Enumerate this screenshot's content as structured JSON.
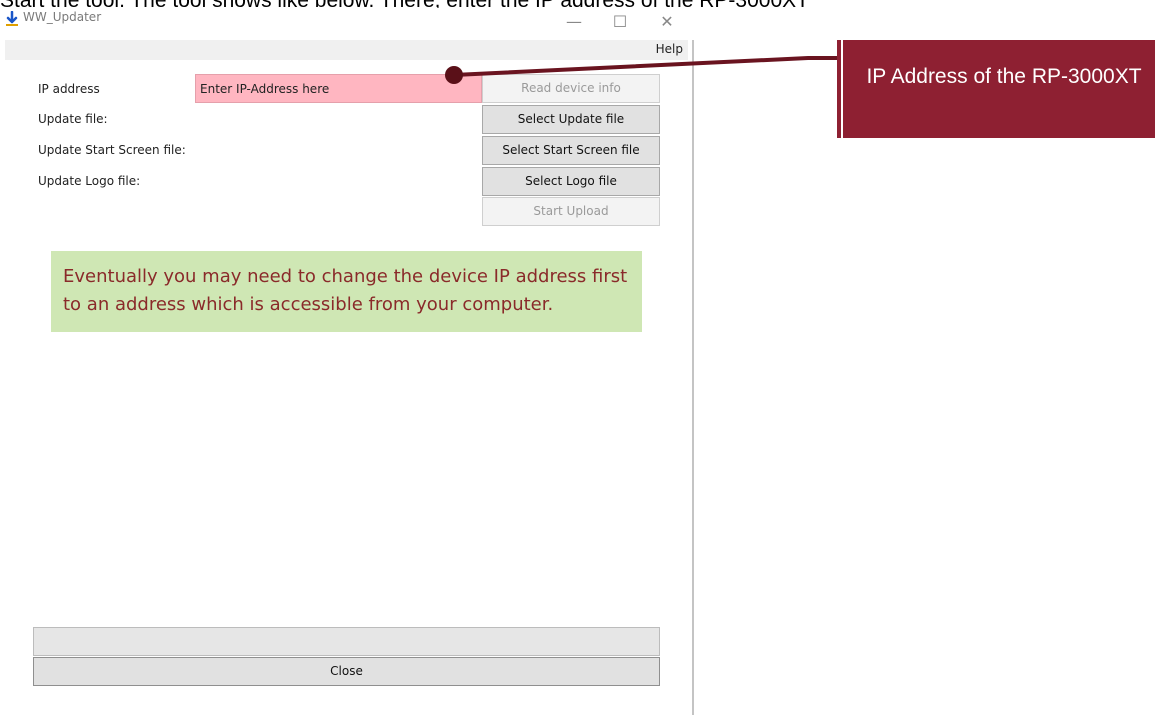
{
  "document": {
    "intro_text": "Start the tool. The tool shows like below. There, enter the IP address of the RP-3000XT"
  },
  "window": {
    "title": "WW_Updater",
    "controls": {
      "minimize": "—",
      "maximize": "☐",
      "close": "✕"
    },
    "menu": {
      "help": "Help"
    }
  },
  "form": {
    "labels": {
      "ip_address": "IP address",
      "update_file": "Update file:",
      "start_screen_file": "Update Start Screen file:",
      "logo_file": "Update Logo file:"
    },
    "ip_input": {
      "placeholder": "Enter IP-Address here",
      "value": ""
    },
    "buttons": {
      "read_device_info": "Read device info",
      "select_update_file": "Select Update file",
      "select_start_screen_file": "Select Start Screen file",
      "select_logo_file": "Select Logo file",
      "start_upload": "Start Upload"
    }
  },
  "note": {
    "text": "Eventually you may need to change the device IP address first to an address which is accessible from your computer."
  },
  "footer": {
    "close_label": "Close"
  },
  "callout": {
    "text": "IP Address of the RP-3000XT"
  },
  "colors": {
    "ip_input_bg": "#ffb6c1",
    "note_bg": "#cfe7b4",
    "note_text": "#8a2a2a",
    "callout_bg": "#8e2032",
    "app_icon": "#1a56c8"
  },
  "icons": {
    "app": "download-arrow-icon"
  }
}
